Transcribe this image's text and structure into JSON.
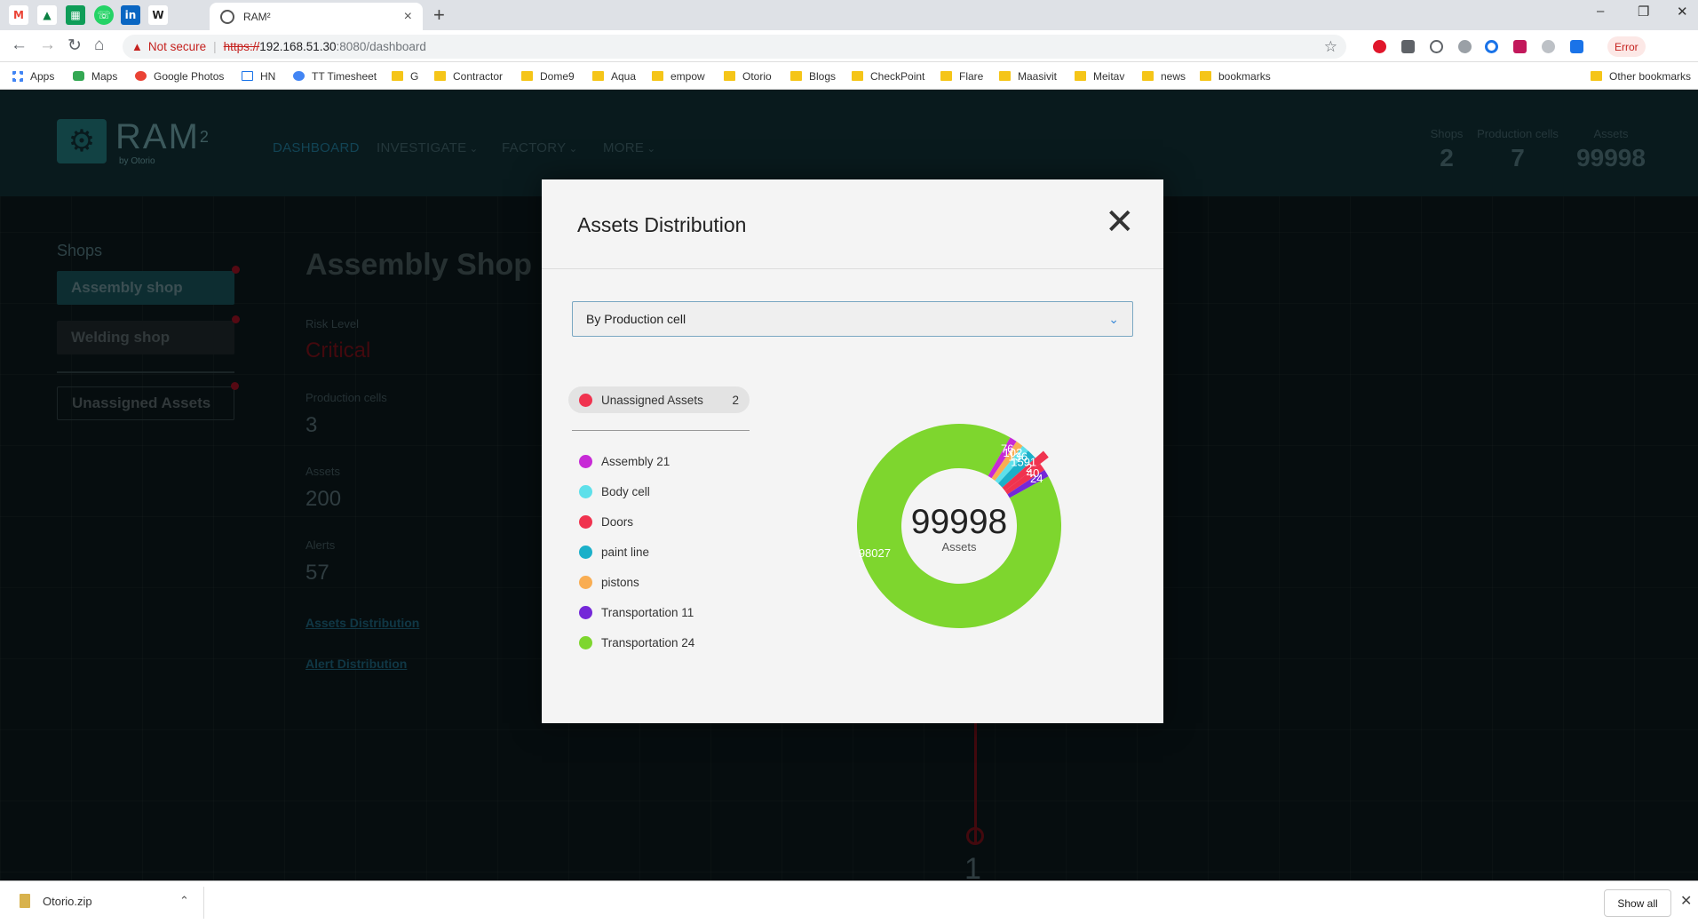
{
  "browser": {
    "tab_title": "RAM²",
    "tab_close": "×",
    "new_tab": "+",
    "minimize": "–",
    "restore": "❐",
    "close": "✕",
    "security_label": "Not secure",
    "url_scheme": "https://",
    "url_host": "192.168.51.30",
    "url_path": ":8080/dashboard",
    "error_label": "Error",
    "bookmarks": [
      "Apps",
      "Maps",
      "Google Photos",
      "HN",
      "TT Timesheet",
      "G",
      "Contractor",
      "Dome9",
      "Aqua",
      "empow",
      "Otorio",
      "Blogs",
      "CheckPoint",
      "Flare",
      "Maasivit",
      "Meitav",
      "news",
      "bookmarks"
    ],
    "other_bookmarks": "Other bookmarks",
    "icons": {
      "back": "back-icon",
      "forward": "forward-icon",
      "reload": "reload-icon",
      "home": "home-icon",
      "star": "star-icon"
    }
  },
  "app": {
    "logo_text": "RAM",
    "logo_sup": "2",
    "logo_by": "by Otorio",
    "nav": [
      {
        "label": "DASHBOARD"
      },
      {
        "label": "INVESTIGATE"
      },
      {
        "label": "FACTORY"
      },
      {
        "label": "MORE"
      }
    ],
    "stats": [
      {
        "label": "Shops",
        "value": "2"
      },
      {
        "label": "Production cells",
        "value": "7"
      },
      {
        "label": "Assets",
        "value": "99998"
      }
    ],
    "sidebar": {
      "title": "Shops",
      "shops": [
        {
          "label": "Assembly shop"
        },
        {
          "label": "Welding shop"
        }
      ],
      "unassigned": "Unassigned Assets"
    },
    "main": {
      "title": "Assembly Shop Risk",
      "risk_label": "Risk Level",
      "risk_value": "Critical",
      "cells_label": "Production cells",
      "cells_value": "3",
      "assets_label": "Assets",
      "assets_value": "200",
      "alerts_label": "Alerts",
      "alerts_value": "57",
      "link_assets": "Assets Distribution",
      "link_alerts": "Alert Distribution",
      "timeline_value": "1"
    }
  },
  "modal": {
    "title": "Assets Distribution",
    "close": "✕",
    "select_value": "By Production cell",
    "unassigned_chip": {
      "label": "Unassigned Assets",
      "count": "2",
      "color": "#f0334f"
    },
    "legend": [
      {
        "label": "Assembly 21",
        "color": "#c72ad6"
      },
      {
        "label": "Body cell",
        "color": "#5ee0ea"
      },
      {
        "label": "Doors",
        "color": "#f0334f"
      },
      {
        "label": "paint line",
        "color": "#1bb0c9"
      },
      {
        "label": "pistons",
        "color": "#f9ad52"
      },
      {
        "label": "Transportation 11",
        "color": "#7428d8"
      },
      {
        "label": "Transportation 24",
        "color": "#7ed62e"
      }
    ],
    "center_value": "99998",
    "center_label": "Assets"
  },
  "chart_data": {
    "type": "pie",
    "categories": [
      "Transportation 24",
      "Assembly 21",
      "pistons",
      "Body cell",
      "paint line",
      "Unassigned Assets",
      "Doors",
      "Transportation 11"
    ],
    "values": [
      98027,
      76,
      102,
      136,
      1591,
      2,
      40,
      24
    ],
    "colors": [
      "#7ed62e",
      "#c72ad6",
      "#f9ad52",
      "#5ee0ea",
      "#1bb0c9",
      "#f0334f",
      "#f0334f",
      "#7428d8"
    ],
    "total": 99998
  },
  "downloads": {
    "file": "Otorio.zip",
    "show_all": "Show all",
    "close": "✕"
  }
}
